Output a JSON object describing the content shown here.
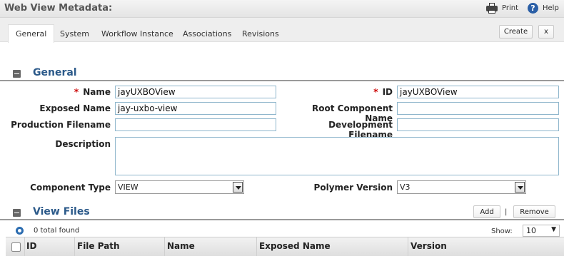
{
  "window": {
    "title": "Web View Metadata:"
  },
  "toolbar": {
    "print_label": "Print",
    "help_label": "Help",
    "print_icon": "printer-icon",
    "help_icon": "help-icon"
  },
  "tabs": [
    {
      "label": "General",
      "active": true
    },
    {
      "label": "System",
      "active": false
    },
    {
      "label": "Workflow Instance",
      "active": false
    },
    {
      "label": "Associations",
      "active": false
    },
    {
      "label": "Revisions",
      "active": false
    }
  ],
  "actions": {
    "create_label": "Create",
    "close_label": "x"
  },
  "general": {
    "title": "General",
    "name": {
      "label": "Name",
      "value": "jayUXBOView",
      "required": true
    },
    "id": {
      "label": "ID",
      "value": "jayUXBOView",
      "required": true
    },
    "exposed_name": {
      "label": "Exposed Name",
      "value": "jay-uxbo-view"
    },
    "root_component_name": {
      "label": "Root Component Name",
      "value": ""
    },
    "production_filename": {
      "label": "Production Filename",
      "value": ""
    },
    "development_filename": {
      "label": "Development Filename",
      "value": ""
    },
    "description": {
      "label": "Description",
      "value": ""
    },
    "component_type": {
      "label": "Component Type",
      "value": "VIEW"
    },
    "polymer_version": {
      "label": "Polymer Version",
      "value": "V3"
    },
    "required_marker": "*"
  },
  "view_files": {
    "title": "View Files",
    "add_label": "Add",
    "separator": "|",
    "remove_label": "Remove",
    "total_text": "0 total found",
    "show_label": "Show:",
    "show_value": "10",
    "columns": [
      "ID",
      "File Path",
      "Name",
      "Exposed Name",
      "Version"
    ]
  },
  "colors": {
    "section_title": "#2c5a8a",
    "required": "#cc0000",
    "field_border": "#8fb6cc"
  }
}
